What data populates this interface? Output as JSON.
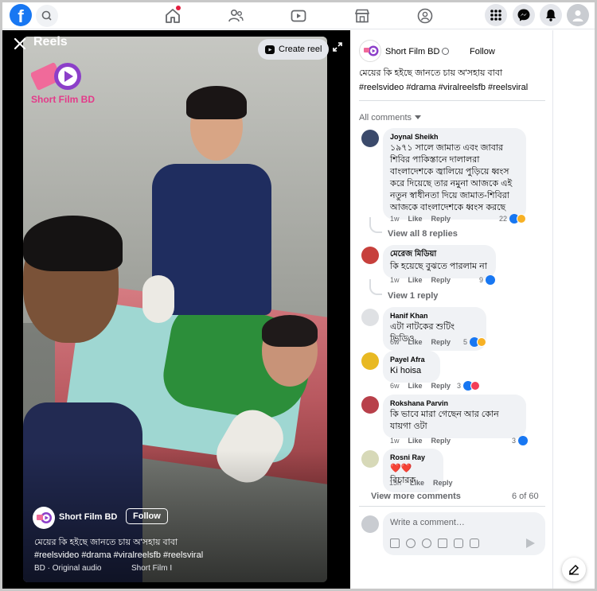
{
  "topbar": {
    "logo": "f",
    "icons": [
      "facebook-logo",
      "search-icon",
      "home-icon",
      "friends-icon",
      "watch-icon",
      "marketplace-icon",
      "groups-icon",
      "menu-grid-icon",
      "messenger-icon",
      "bell-icon",
      "profile-avatar"
    ]
  },
  "reel": {
    "title": "Reels",
    "create_reel": "Create reel",
    "brand_logo_text": "Short Film BD",
    "page_name": "Short Film BD",
    "follow": "Follow",
    "caption": "মেয়ের কি হইছে জানতে চায় অ'সহায় বাবা",
    "tags": "#reelsvideo #drama #viralreelsfb #reelsviral",
    "audio": "BD · Original audio",
    "audio_right": "Short Film I"
  },
  "post": {
    "page_name": "Short Film BD",
    "follow": "Follow",
    "caption": "মেয়ের কি হইছে জানতে চায় অ'সহায় বাবা",
    "tags": "#reelsvideo #drama #viralreelsfb #reelsviral",
    "all_comments": "All comments"
  },
  "comments": [
    {
      "author": "Joynal Sheikh",
      "text": "১৯৭১ সালে জামাত এবং জাবার শিবির পাকিস্তানে দালালরা বাংলাদেশকে জ্বালিয়ে পুড়িয়ে ধ্বংস করে দিয়েছে তার নমুনা আজকে এই নতুন স্বাধীনতা দিয়ে জামাত-শিবিরা আজকে বাংলাদেশকে ধ্বংস করছে",
      "ago": "1w",
      "like": "Like",
      "reply": "Reply",
      "reactions": "22",
      "view_replies": "View all 8 replies"
    },
    {
      "author": "মেরেজ মিডিয়া",
      "text": "কি হয়েছে বুঝতে পারলাম না",
      "ago": "1w",
      "like": "Like",
      "reply": "Reply",
      "reactions": "9",
      "view_replies": "View 1 reply"
    },
    {
      "author": "Hanif Khan",
      "text": "এটা নাটকের শুটিং ভিডিও",
      "ago": "6w",
      "like": "Like",
      "reply": "Reply",
      "reactions": "5"
    },
    {
      "author": "Payel Afra",
      "text": "Ki hoisa",
      "ago": "6w",
      "like": "Like",
      "reply": "Reply",
      "reactions": "3"
    },
    {
      "author": "Rokshana Parvin",
      "text": "কি ভাবে মারা গেছেন আর কোন যায়গা ওটা",
      "ago": "1w",
      "like": "Like",
      "reply": "Reply",
      "reactions": "3"
    },
    {
      "author": "Rosni Ray",
      "text": "❤️❤️ বিচারক",
      "ago": "15h",
      "like": "Like",
      "reply": "Reply",
      "reactions": ""
    }
  ],
  "footer": {
    "view_more": "View more comments",
    "count": "6 of 60",
    "comment_placeholder": "Write a comment…"
  },
  "colors": {
    "brand_blue": "#1877f2",
    "bubble_bg": "#f0f2f5",
    "muted_text": "#65676b"
  }
}
